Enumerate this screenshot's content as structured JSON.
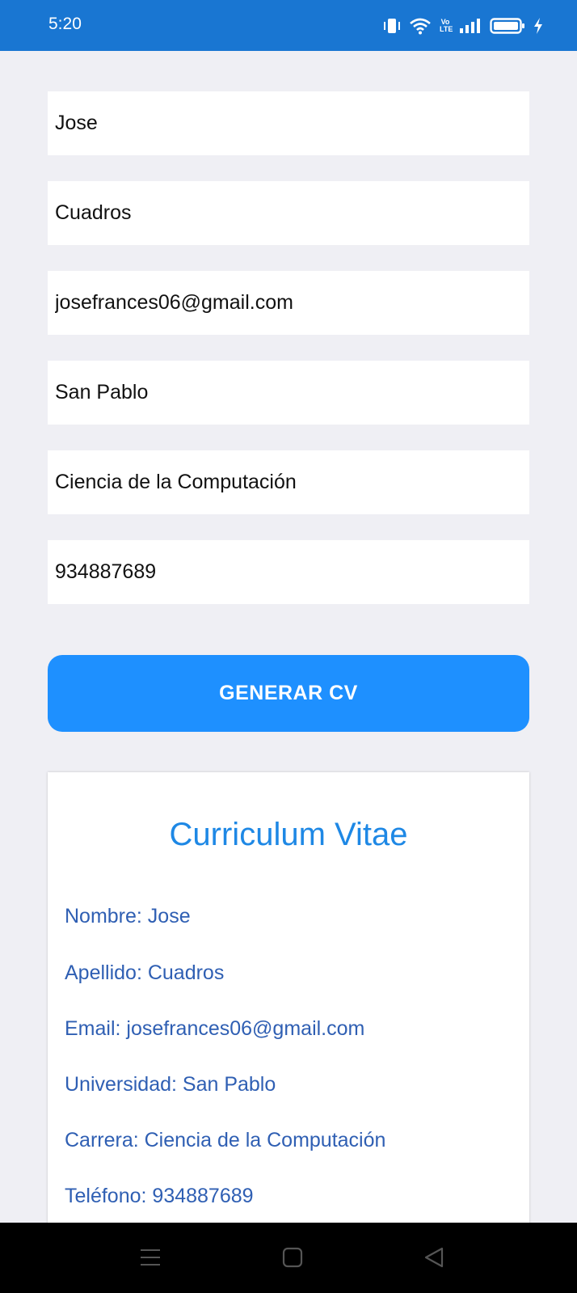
{
  "status_bar": {
    "time": "5:20",
    "volte_top": "Vo",
    "volte_bottom": "LTE",
    "icons": [
      "vibrate-icon",
      "wifi-icon",
      "volte-icon",
      "signal-icon",
      "battery-icon",
      "charging-icon"
    ]
  },
  "form": {
    "nombre": "Jose",
    "apellido": "Cuadros",
    "email": "josefrances06@gmail.com",
    "universidad": "San Pablo",
    "carrera": "Ciencia de la Computación",
    "telefono": "934887689"
  },
  "generate_button": {
    "label": "GENERAR CV"
  },
  "cv": {
    "title": "Curriculum Vitae",
    "nombre": "Nombre: Jose",
    "apellido": "Apellido: Cuadros",
    "email": "Email: josefrances06@gmail.com",
    "universidad": "Universidad: San Pablo",
    "carrera": "Carrera: Ciencia de la Computación",
    "telefono": "Teléfono: 934887689"
  },
  "nav_bar": {
    "icons": [
      "menu-icon",
      "home-icon",
      "back-icon"
    ]
  },
  "colors": {
    "status_bar": "#1976d2",
    "background": "#efeff4",
    "button": "#1e90ff",
    "cv_title": "#1e88e5",
    "cv_text": "#2f5fb3"
  }
}
